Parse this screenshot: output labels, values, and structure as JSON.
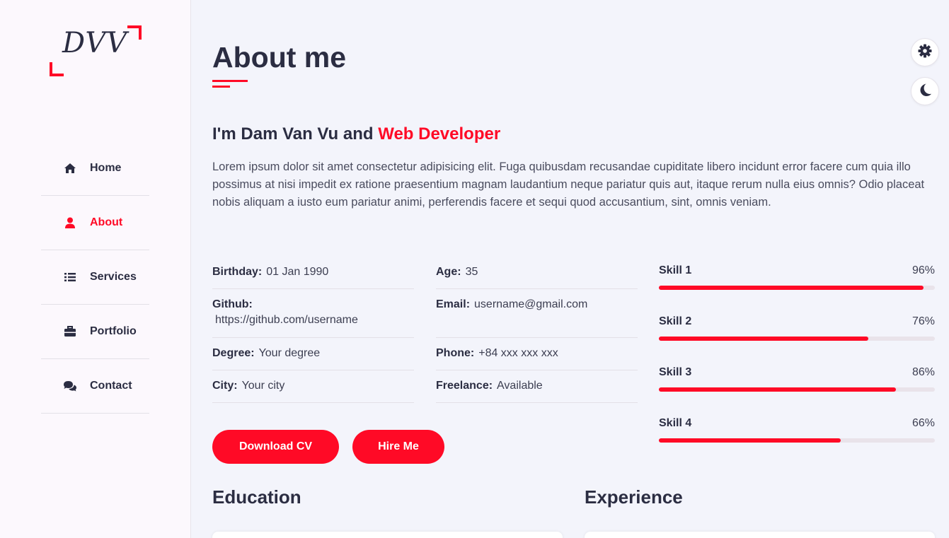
{
  "sidebar": {
    "logo_text": "DVV",
    "items": [
      {
        "label": "Home",
        "icon": "home-icon",
        "active": false
      },
      {
        "label": "About",
        "icon": "user-icon",
        "active": true
      },
      {
        "label": "Services",
        "icon": "list-icon",
        "active": false
      },
      {
        "label": "Portfolio",
        "icon": "briefcase-icon",
        "active": false
      },
      {
        "label": "Contact",
        "icon": "chat-icon",
        "active": false
      }
    ]
  },
  "main": {
    "title": "About me",
    "intro_prefix": "I'm Dam Van Vu and ",
    "intro_role": "Web Developer",
    "description": "Lorem ipsum dolor sit amet consectetur adipisicing elit. Fuga quibusdam recusandae cupiditate libero incidunt error facere cum quia illo possimus at nisi impedit ex ratione praesentium magnam laudantium neque pariatur quis aut, itaque rerum nulla eius omnis? Odio placeat nobis aliquam a iusto eum pariatur animi, perferendis facere et sequi quod accusantium, sint, omnis veniam.",
    "info_left": [
      {
        "key": "Birthday:",
        "value": "01 Jan 1990"
      },
      {
        "key": "Github:",
        "value": "https://github.com/username"
      },
      {
        "key": "Degree:",
        "value": "Your degree"
      },
      {
        "key": "City:",
        "value": "Your city"
      }
    ],
    "info_right": [
      {
        "key": "Age:",
        "value": "35"
      },
      {
        "key": "Email:",
        "value": "username@gmail.com"
      },
      {
        "key": "Phone:",
        "value": "+84 xxx xxx xxx"
      },
      {
        "key": "Freelance:",
        "value": "Available"
      }
    ],
    "buttons": {
      "download_cv": "Download CV",
      "hire_me": "Hire Me"
    },
    "skills": [
      {
        "name": "Skill 1",
        "percent_label": "96%",
        "level": 0.96
      },
      {
        "name": "Skill 2",
        "percent_label": "76%",
        "level": 0.76
      },
      {
        "name": "Skill 3",
        "percent_label": "86%",
        "level": 0.86
      },
      {
        "name": "Skill 4",
        "percent_label": "66%",
        "level": 0.66
      }
    ],
    "education_heading": "Education",
    "experience_heading": "Experience"
  },
  "controls": {
    "settings_icon": "gear-icon",
    "theme_icon": "moon-icon"
  },
  "colors": {
    "accent": "#ff0a26",
    "text": "#2b2d42",
    "background": "#f3f4fb",
    "sidebar": "#fcf8fd"
  }
}
